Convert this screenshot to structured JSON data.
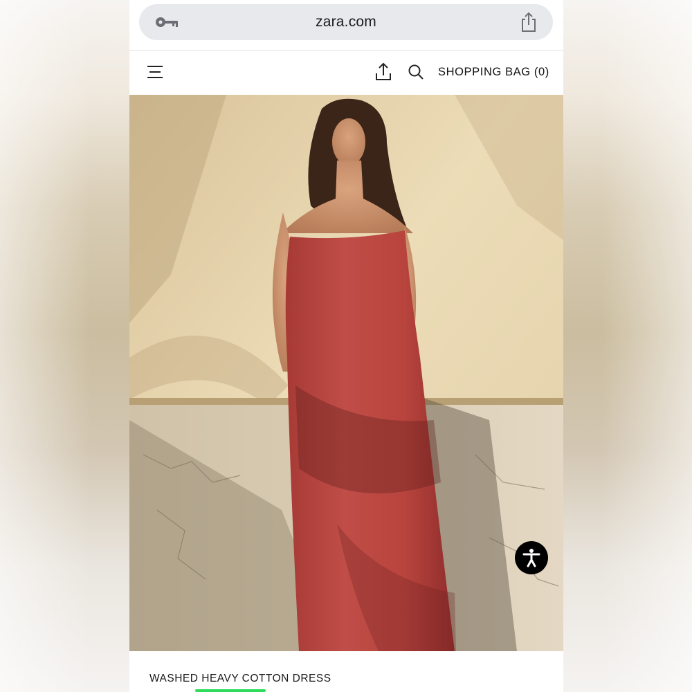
{
  "browser": {
    "url": "zara.com",
    "lock_icon": "key-icon",
    "share_icon": "share-icon"
  },
  "header": {
    "menu_icon": "menu-icon",
    "share_icon": "share-icon",
    "search_icon": "search-icon",
    "bag_label": "SHOPPING BAG (0)"
  },
  "product": {
    "title": "WASHED HEAVY COTTON DRESS",
    "image": {
      "wall_color": "#e6d2a8",
      "dress_color": "#b8443f"
    }
  },
  "accessibility": {
    "icon": "accessibility-icon"
  },
  "colors": {
    "accent_line": "#2fdc5b"
  }
}
